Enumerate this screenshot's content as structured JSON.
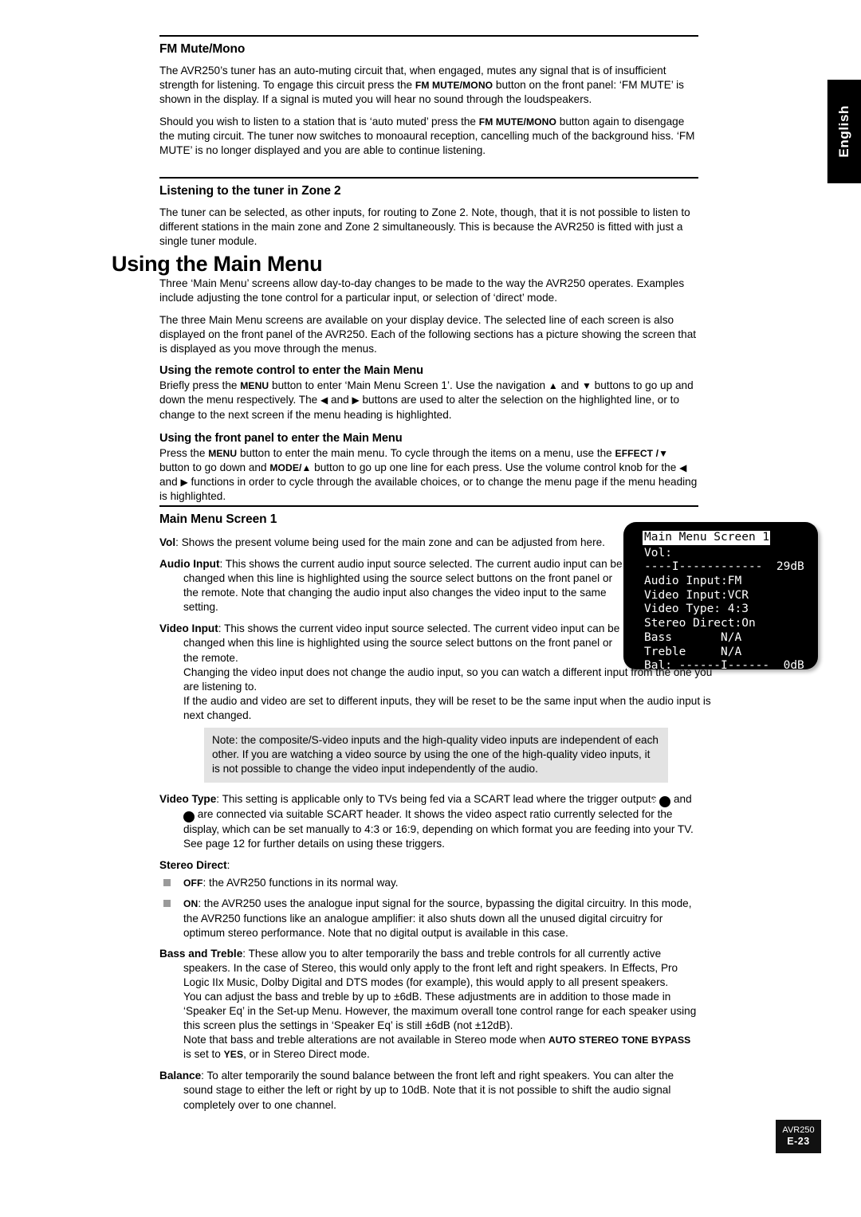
{
  "language_tab": {
    "label": "English"
  },
  "sections": {
    "fm_mute": {
      "heading": "FM Mute/Mono",
      "p1_a": "The AVR250’s tuner has an auto-muting circuit that, when engaged, mutes any signal that is of insufficient strength for listening. To engage this circuit press the ",
      "p1_kbd": "FM MUTE/MONO",
      "p1_b": " button on the front panel: ‘FM MUTE’ is shown in the display. If a signal is muted you will hear no sound through the loudspeakers.",
      "p2_a": "Should you wish to listen to a station that is ‘auto muted’ press the ",
      "p2_kbd": "FM MUTE/MONO",
      "p2_b": " button again to disengage the muting circuit. The tuner now switches to monoaural reception, cancelling much of the background hiss. ‘FM MUTE’ is no longer displayed and you are able to continue listening."
    },
    "zone2": {
      "heading": "Listening to the tuner in Zone 2",
      "p1": "The tuner can be selected, as other inputs, for routing to Zone 2. Note, though, that it is not possible to listen to different stations in the main zone and Zone 2 simultaneously. This is because the AVR250 is fitted with just a single tuner module."
    },
    "using_main_menu": {
      "title": "Using the Main Menu",
      "p1": "Three ‘Main Menu’ screens allow day-to-day changes to be made to the way the AVR250 operates. Examples include adjusting the tone control for a particular input, or selection of ‘direct’ mode.",
      "p2": "The three Main Menu screens are available on your display device. The selected line of each screen is also displayed on the front panel of the AVR250. Each of the following sections has a picture showing the screen that is displayed as you move through the menus.",
      "remote": {
        "heading": "Using the remote control to enter the Main Menu",
        "a": "Briefly press the ",
        "kbd": "MENU",
        "b": " button to enter ‘Main Menu Screen 1’. Use the navigation ",
        "up": "▲",
        "c": " and ",
        "down": "▼",
        "d": " buttons to go up and down the menu respectively. The ",
        "left": "◀",
        "e": " and ",
        "right": "▶",
        "f": " buttons are used to alter the selection on the highlighted line, or to change to the next screen if the menu heading is highlighted."
      },
      "front_panel": {
        "heading": "Using the front panel to enter the Main Menu",
        "a": "Press the ",
        "kbd1": "MENU",
        "b": " button to enter the main menu. To cycle through the items on a menu, use the ",
        "kbd2": "EFFECT /",
        "down": "▼",
        "c": " button to go down and ",
        "kbd3": "MODE/",
        "up": "▲",
        "d": " button to go up one line for each press. Use the volume control knob for the ",
        "left": "◀",
        "e": " and ",
        "right": "▶",
        "f": " functions in order to cycle through the available choices, or to change the menu page if the menu heading is highlighted."
      }
    },
    "main_menu_screen_1": {
      "heading": "Main Menu Screen 1",
      "entries": [
        {
          "term": "Vol",
          "body": ": Shows the present volume being used for the main zone and can be adjusted from here."
        },
        {
          "term": "Audio Input",
          "body": ": This shows the current audio input source selected. The current audio input can be changed when this line is highlighted using the source select buttons on the front panel or the remote. Note that changing the audio input also changes the video input to the same setting."
        },
        {
          "term": "Video Input",
          "body": ": This shows the current video input source selected. The current video input can be changed when this line is highlighted using the source select buttons on the front panel or the remote.",
          "cont1": "Changing the video input does not change the audio input, so you can watch a different input from the one you are listening to.",
          "cont2": "If the audio and video are set to different inputs, they will be reset to be the same input when the audio input is next changed."
        }
      ],
      "note": "Note: the composite/S-video inputs and the high-quality video inputs are independent of each other. If you are watching a video source by using the one of the high-quality video inputs, it is not possible to change the video input independently of the audio.",
      "video_type": {
        "term": "Video Type",
        "a": ": This setting is applicable only to TVs being fed via a SCART lead where the trigger outputs ",
        "badge1": "51",
        "b": " and ",
        "badge2": "52",
        "c": " are connected via suitable SCART header. It shows the video aspect ratio currently selected for the display, which can be set manually to 4:3 or 16:9, depending on which format you are feeding into your TV. See page 12 for further details on using these triggers."
      },
      "stereo_direct": {
        "term": "Stereo Direct",
        "colon": ":",
        "items": [
          {
            "label": "OFF",
            "text": ": the AVR250 functions in its normal way."
          },
          {
            "label": "ON",
            "text": ": the AVR250 uses the analogue input signal for the source, bypassing the digital circuitry. In this mode, the AVR250 functions like an analogue amplifier: it also shuts down all the unused digital circuitry for optimum stereo performance. Note that no digital output is available in this case."
          }
        ]
      },
      "bass_treble": {
        "term": "Bass and Treble",
        "body": ": These allow you to alter temporarily the bass and treble controls for all currently active speakers. In the case of Stereo, this would only apply to the front left and right speakers. In Effects, Pro Logic IIx Music, Dolby Digital and DTS modes (for example), this would apply to all present speakers.",
        "cont1": "You can adjust the bass and treble by up to ±6dB. These adjustments are in addition to those made in ‘Speaker Eq’ in the Set-up Menu. However, the maximum overall tone control range for each speaker using this screen plus the settings in ‘Speaker Eq’ is still ±6dB (not ±12dB).",
        "cont2_a": "Note that bass and treble alterations are not available in Stereo mode when ",
        "cont2_kbd1": "AUTO STEREO TONE BYPASS",
        "cont2_b": " is set to ",
        "cont2_kbd2": "YES",
        "cont2_c": ", or in Stereo Direct mode."
      },
      "balance": {
        "term": "Balance",
        "body": ": To alter temporarily the sound balance between the front left and right speakers. You can alter the sound stage to either the left or right by up to 10dB. Note that it is not possible to shift the audio signal completely over to one channel."
      }
    }
  },
  "lcd": {
    "title": "Main Menu Screen 1",
    "lines": [
      "Vol:",
      "----I------------  29dB",
      "Audio Input:FM",
      "Video Input:VCR",
      "Video Type: 4:3",
      "Stereo Direct:On",
      "Bass       N/A",
      "Treble     N/A",
      "Bal: ------I------  0dB"
    ]
  },
  "footer": {
    "model": "AVR250",
    "page": "E-23"
  }
}
